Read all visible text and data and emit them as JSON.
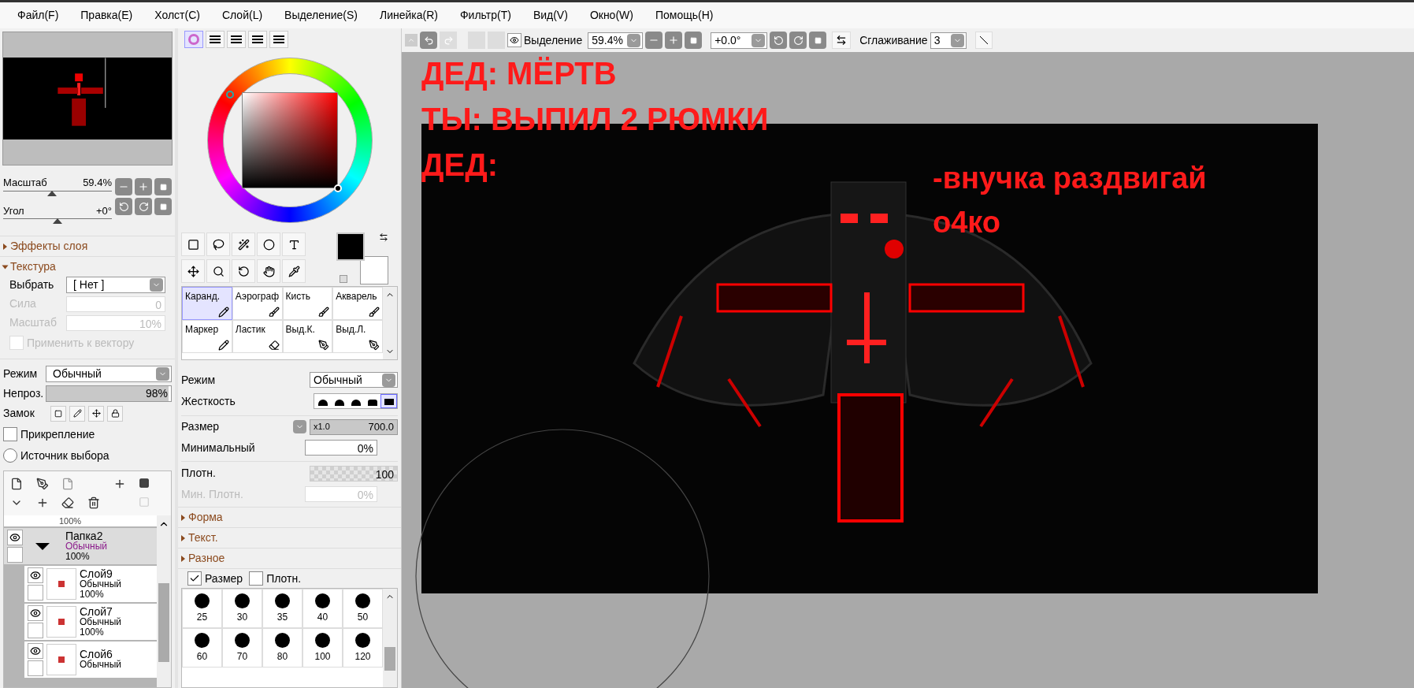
{
  "menu": [
    {
      "label": "Файл(F)"
    },
    {
      "label": "Правка(E)"
    },
    {
      "label": "Холст(C)"
    },
    {
      "label": "Слой(L)"
    },
    {
      "label": "Выделение(S)"
    },
    {
      "label": "Линейка(R)"
    },
    {
      "label": "Фильтр(T)"
    },
    {
      "label": "Вид(V)"
    },
    {
      "label": "Окно(W)"
    },
    {
      "label": "Помощь(H)"
    }
  ],
  "navigator": {
    "zoom": {
      "label": "Масштаб",
      "value": "59.4%",
      "level": 0.45
    },
    "angle": {
      "label": "Угол",
      "value": "+0°",
      "level": 0.5
    }
  },
  "layer_effects": {
    "label": "Эффекты слоя",
    "expanded": false
  },
  "texture": {
    "label": "Текстура",
    "expanded": true,
    "select_label": "Выбрать",
    "select_value": "[ Нет ]",
    "strength_label": "Сила",
    "strength_value": "0",
    "scale_label": "Масштаб",
    "scale_value": "10%",
    "apply_label": "Применить к вектору",
    "apply_checked": false
  },
  "layer_props": {
    "mode_label": "Режим",
    "mode_value": "Обычный",
    "opacity": {
      "label": "Непроз.",
      "value": "98%",
      "level": 0.98
    },
    "lock_label": "Замок",
    "clipping": {
      "label": "Прикрепление",
      "checked": false
    },
    "selection_source": {
      "label": "Источник выбора",
      "checked": false
    }
  },
  "layers": {
    "cut_row_opacity": "100%",
    "folder": {
      "name": "Папка2",
      "mode": "Обычный",
      "opacity": "100%",
      "selected": true,
      "expanded": true,
      "visible": true,
      "children": [
        {
          "name": "Слой9",
          "mode": "Обычный",
          "opacity": "100%",
          "visible": true
        },
        {
          "name": "Слой7",
          "mode": "Обычный",
          "opacity": "100%",
          "visible": true
        },
        {
          "name": "Слой6",
          "mode": "Обычный",
          "visible": true
        }
      ]
    }
  },
  "color_tabs": [
    {
      "kind": "wheel",
      "selected": true
    },
    {
      "kind": "rgb",
      "selected": false
    },
    {
      "kind": "hsv",
      "selected": false
    },
    {
      "kind": "swatches",
      "selected": false
    },
    {
      "kind": "scratch",
      "selected": false
    }
  ],
  "swatches": [
    {
      "kind": "primary",
      "color": "#000000"
    },
    {
      "kind": "secondary",
      "color": "#ffffff"
    }
  ],
  "brushes": [
    {
      "name": "Каранд.",
      "selected": true
    },
    {
      "name": "Аэрограф",
      "selected": false
    },
    {
      "name": "Кисть",
      "selected": false
    },
    {
      "name": "Акварель",
      "selected": false
    },
    {
      "name": "Маркер",
      "selected": false
    },
    {
      "name": "Ластик",
      "selected": false
    },
    {
      "name": "Выд.К.",
      "selected": false
    },
    {
      "name": "Выд.Л.",
      "selected": false
    }
  ],
  "brush_settings": {
    "mode_label": "Режим",
    "mode_value": "Обычный",
    "hardness_label": "Жесткость",
    "hardness": [
      {
        "selected": false
      },
      {
        "selected": false
      },
      {
        "selected": false
      },
      {
        "selected": false
      },
      {
        "selected": true
      }
    ],
    "size": {
      "label": "Размер",
      "multiplier": "x1.0",
      "value": "700.0",
      "level": 1
    },
    "min_size_label": "Минимальный",
    "min_size_value": "0%",
    "density": {
      "label": "Плотн.",
      "value": "100",
      "level": 1
    },
    "min_density_label": "Мин. Плотн.",
    "min_density_value": "0%",
    "sections": [
      {
        "label": "Форма",
        "expanded": false
      },
      {
        "label": "Текст.",
        "expanded": false
      },
      {
        "label": "Разное",
        "expanded": false
      }
    ],
    "checks": [
      {
        "label": "Размер",
        "checked": true
      },
      {
        "label": "Плотн.",
        "checked": false
      }
    ],
    "sizes": [
      "25",
      "30",
      "35",
      "40",
      "50",
      "60",
      "70",
      "80",
      "100",
      "120"
    ]
  },
  "toolbar": {
    "selection_label": "Выделение",
    "zoom": "59.4%",
    "angle": "+0.0°",
    "smoothing_label": "Сглаживание",
    "smoothing": "3"
  },
  "canvas": {
    "captions": [
      "ДЕД: МЁРТВ",
      "ТЫ: ВЫПИЛ 2 РЮМКИ",
      "ДЕД:"
    ],
    "speech": [
      "-внучка раздвигай",
      "о4ко"
    ]
  }
}
